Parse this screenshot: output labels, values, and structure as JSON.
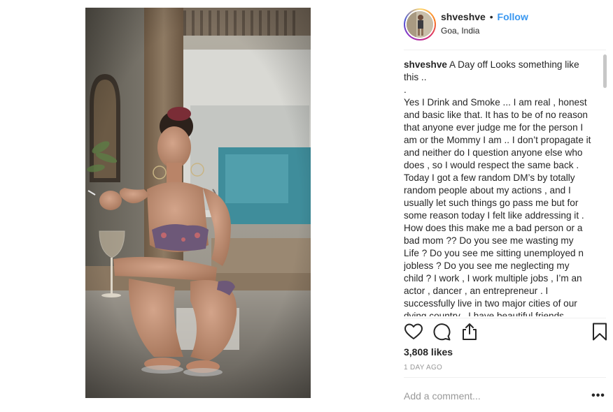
{
  "post": {
    "username": "shveshve",
    "separator": "•",
    "follow_label": "Follow",
    "location": "Goa, India",
    "caption_user": "shveshve",
    "caption_text": " A Day off Looks something like this ..\n.\nYes I Drink and Smoke ... I am real , honest and basic like that. It has to be of no reason that anyone ever judge me for the person I am or the Mommy I am .. I don’t propagate it and neither do I question anyone else who does , so I would respect the same back . Today I got a few random DM’s by totally random people about my actions , and I usually let such things go pass me but for some reason today I felt like addressing it . How does this make me a bad person or a bad mom ?? Do you see me wasting my Life ? Do you see me sitting unemployed n jobless ? Do you see me neglecting my child ? I work , I work multiple jobs , I’m an actor , dancer , an entrepreneur . I successfully live in two major cities of our dying country . I have beautiful friends",
    "likes": "3,808 likes",
    "timestamp": "1 DAY AGO"
  },
  "comment": {
    "placeholder": "Add a comment...",
    "more_label": "•••"
  },
  "icons": {
    "like": "heart-icon",
    "comment": "comment-bubble-icon",
    "share": "share-icon",
    "save": "bookmark-icon",
    "more": "more-options-icon"
  },
  "colors": {
    "follow": "#3897f0",
    "text": "#262626",
    "muted": "#999999",
    "divider": "#efefef"
  }
}
